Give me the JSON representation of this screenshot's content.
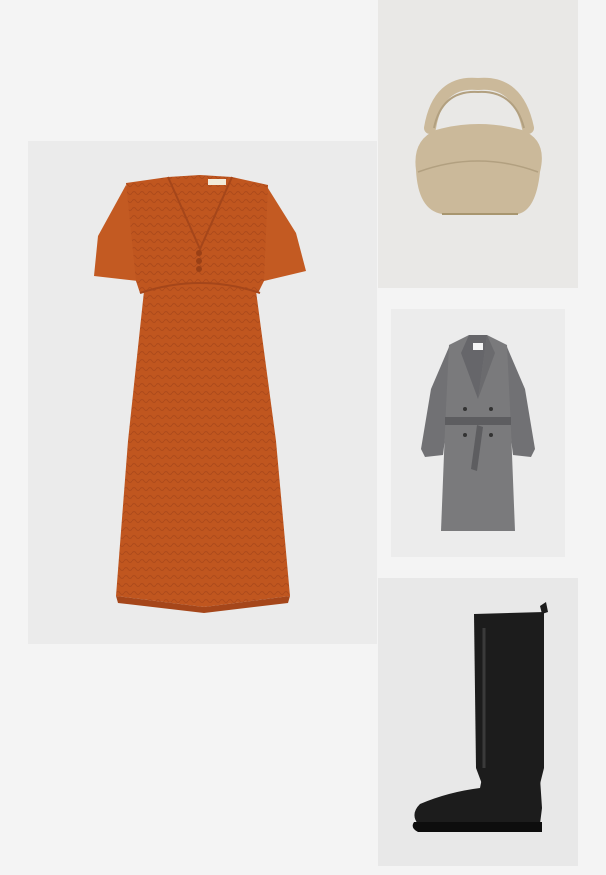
{
  "board": {
    "background": "#f4f4f4",
    "tile_background": "#e9e9e9"
  },
  "items": {
    "dress": {
      "color": "#c0561f",
      "shade": "#a5461a",
      "label_text": "ANNIEM"
    },
    "bag": {
      "color": "#cbb99a",
      "shade": "#b2a080"
    },
    "coat": {
      "color": "#7a7a7c",
      "shade": "#5d5d60",
      "label_text": "RAY"
    },
    "boot": {
      "color": "#1c1c1c",
      "shade": "#0d0d0d"
    }
  }
}
